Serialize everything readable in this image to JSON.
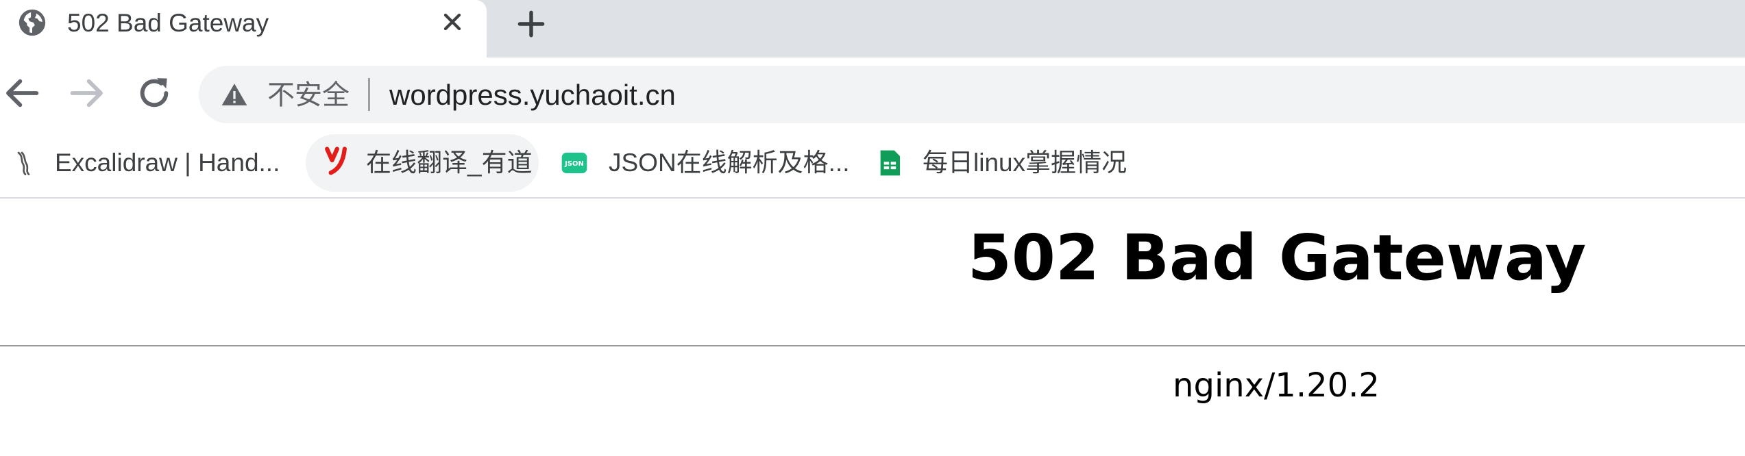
{
  "tab": {
    "title": "502 Bad Gateway",
    "favicon": "globe-icon"
  },
  "toolbar": {
    "back": "back-arrow-icon",
    "forward": "forward-arrow-icon",
    "reload": "reload-icon"
  },
  "omnibox": {
    "security_label": "不安全",
    "url": "wordpress.yuchaoit.cn"
  },
  "bookmarks": [
    {
      "label": "Excalidraw | Hand...",
      "icon": "excalidraw-icon"
    },
    {
      "label": "在线翻译_有道",
      "icon": "youdao-icon"
    },
    {
      "label": "JSON在线解析及格...",
      "icon": "json-icon"
    },
    {
      "label": "每日linux掌握情况",
      "icon": "sheets-icon"
    }
  ],
  "page": {
    "heading": "502 Bad Gateway",
    "server": "nginx/1.20.2"
  },
  "colors": {
    "tabstrip": "#dee1e6",
    "omnibox": "#f1f3f4",
    "youdao_red": "#e31d1a",
    "json_green": "#1ec28b",
    "sheets_green": "#0f9d58"
  }
}
